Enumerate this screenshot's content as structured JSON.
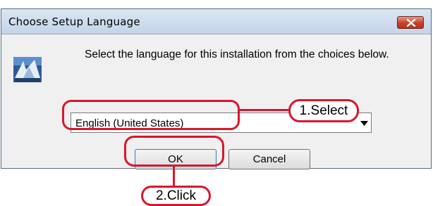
{
  "window": {
    "title": "Choose Setup Language",
    "close_icon": "close-icon",
    "accent_close": "#c7402a"
  },
  "dialog": {
    "icon": "setup-installer-icon",
    "message": "Select the language for this installation from the choices below.",
    "language_select": {
      "selected": "English (United States)",
      "arrow_icon": "chevron-down-icon"
    },
    "buttons": {
      "ok": "OK",
      "cancel": "Cancel"
    }
  },
  "annotations": {
    "color": "#d8172b",
    "select_step": "1.Select",
    "click_step": "2.Click"
  }
}
